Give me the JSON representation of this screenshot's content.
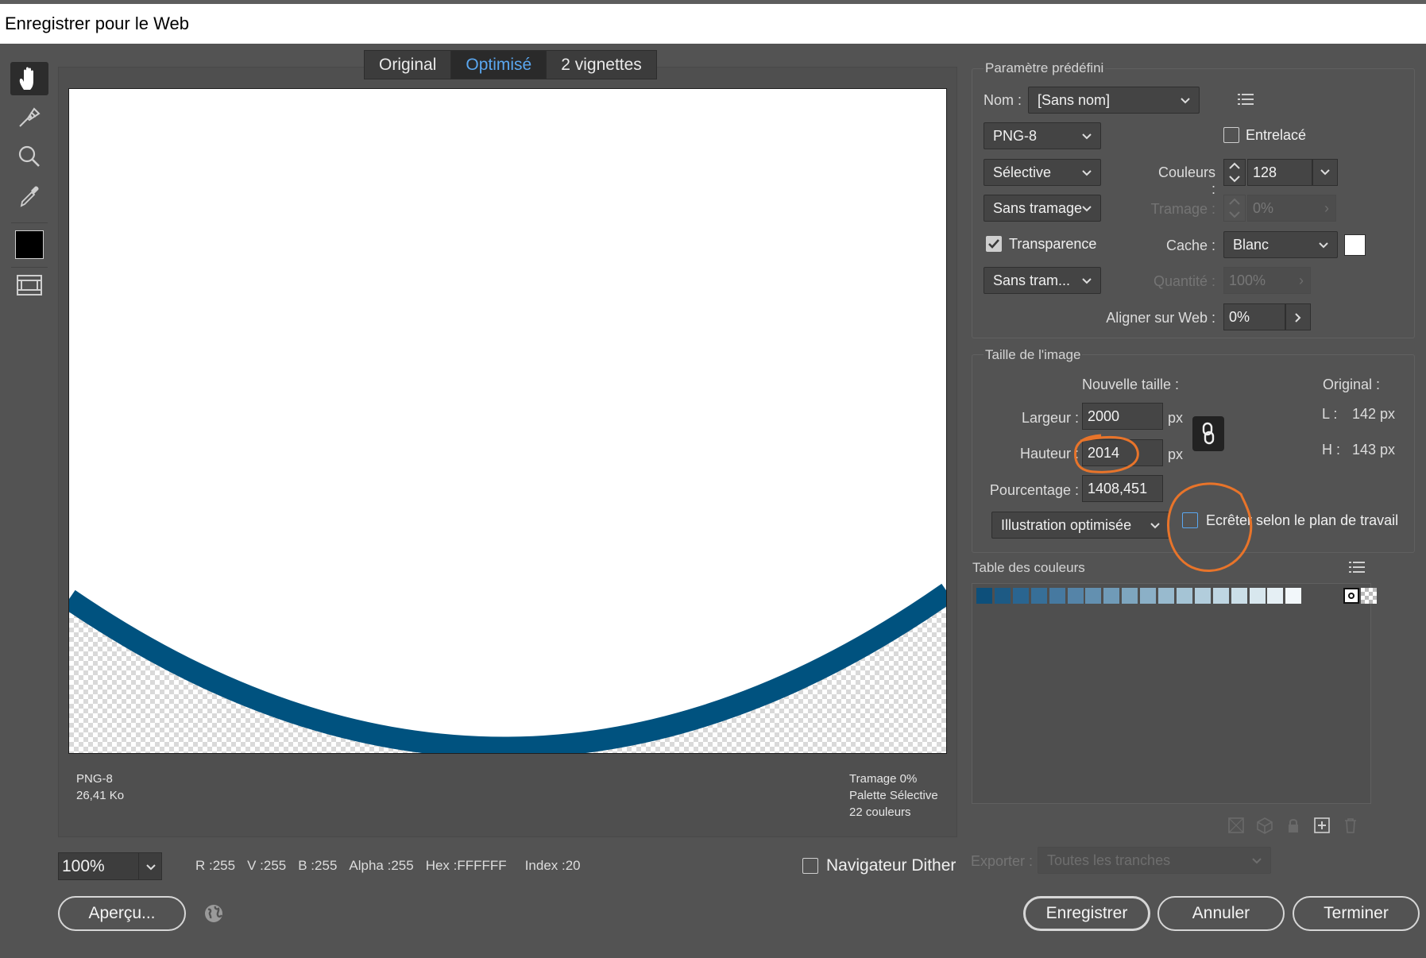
{
  "window": {
    "title": "Enregistrer pour le Web"
  },
  "view_tabs": [
    {
      "label": "Original",
      "active": false
    },
    {
      "label": "Optimisé",
      "active": true
    },
    {
      "label": "2 vignettes",
      "active": false
    }
  ],
  "tools": [
    "hand-tool",
    "slice-select-tool",
    "zoom-tool",
    "eyedropper-tool",
    "eyedropper-color",
    "toggle-slices-visibility"
  ],
  "preview": {
    "left_info": {
      "format": "PNG-8",
      "size": "26,41 Ko"
    },
    "right_info": {
      "dither": "Tramage 0%",
      "palette": "Palette Sélective",
      "colors": "22 couleurs"
    },
    "shape_color": "#00527f"
  },
  "bottom_bar": {
    "zoom": "100%",
    "r": "R :255",
    "v": "V :255",
    "b": "B :255",
    "alpha": "Alpha :255",
    "hex": "Hex :FFFFFF",
    "index": "Index :20",
    "dither_browser_label": "Navigateur Dither",
    "dither_browser_checked": false,
    "preview_button": "Aperçu..."
  },
  "preset": {
    "legend": "Paramètre prédéfini",
    "name_label": "Nom :",
    "name_value": "[Sans nom]",
    "format": "PNG-8",
    "interlaced_label": "Entrelacé",
    "interlaced_checked": false,
    "reduction": "Sélective",
    "colors_label": "Couleurs :",
    "colors_value": "128",
    "dither_algo": "Sans tramage",
    "dither_label": "Tramage :",
    "dither_value": "0%",
    "transparency_label": "Transparence",
    "transparency_checked": true,
    "matte_label": "Cache :",
    "matte_value": "Blanc",
    "matte_color": "#ffffff",
    "transparency_dither": "Sans tram...",
    "amount_label": "Quantité :",
    "amount_value": "100%",
    "web_snap_label": "Aligner sur Web :",
    "web_snap_value": "0%"
  },
  "image_size": {
    "legend": "Taille de l'image",
    "new_size_label": "Nouvelle taille :",
    "original_label": "Original :",
    "width_label": "Largeur :",
    "width_value": "2000",
    "height_label": "Hauteur :",
    "height_value": "2014",
    "unit": "px",
    "percent_label": "Pourcentage :",
    "percent_value": "1408,451",
    "orig_w_label": "L :",
    "orig_w_value": "142 px",
    "orig_h_label": "H :",
    "orig_h_value": "143 px",
    "quality": "Illustration optimisée",
    "clip_label": "Ecrêter selon le plan de travail",
    "clip_checked": false
  },
  "color_table": {
    "legend": "Table des couleurs",
    "swatches": [
      "#0d4f7a",
      "#1d5a84",
      "#2a6590",
      "#376f98",
      "#4679a0",
      "#5584a8",
      "#6390b0",
      "#709bb8",
      "#7ea6bf",
      "#8bb0c7",
      "#98bace",
      "#a5c4d5",
      "#b2cddc",
      "#bfd6e2",
      "#cbdfe8",
      "#d8e7ee",
      "#e5eff4",
      "#f2f7fa",
      "#ffffff"
    ]
  },
  "export": {
    "label": "Exporter :",
    "value": "Toutes les tranches"
  },
  "buttons": {
    "save": "Enregistrer",
    "cancel": "Annuler",
    "done": "Terminer"
  },
  "annotations": {
    "circle_color": "#e8742a"
  }
}
